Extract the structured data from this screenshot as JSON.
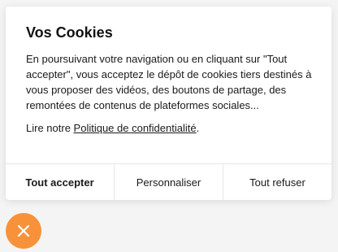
{
  "cookie_banner": {
    "title": "Vos Cookies",
    "body": "En poursuivant votre navigation ou en cliquant sur \"Tout accepter\", vous acceptez le dépôt de cookies tiers destinés à vous proposer des vidéos, des boutons de partage, des remontées de contenus de plateformes sociales...",
    "privacy_prefix": "Lire notre ",
    "privacy_link": "Politique de confidentialité",
    "privacy_suffix": ".",
    "buttons": {
      "accept_all": "Tout accepter",
      "customize": "Personnaliser",
      "refuse_all": "Tout refuser"
    }
  },
  "close_button": {
    "icon": "close-icon",
    "color": "#F7923A"
  }
}
